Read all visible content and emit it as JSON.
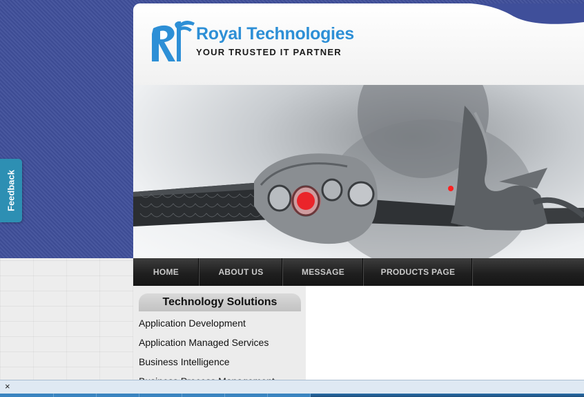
{
  "brand": {
    "name": "Royal Technologies",
    "tagline": "YOUR TRUSTED IT PARTNER",
    "colors": {
      "primary": "#2d8fd6",
      "background": "#3f4f9a"
    }
  },
  "hero": {
    "icon": "hand-with-rings-and-dragon-sword-image"
  },
  "nav": {
    "items": [
      {
        "label": "HOME"
      },
      {
        "label": "ABOUT US"
      },
      {
        "label": "MESSAGE"
      },
      {
        "label": "PRODUCTS PAGE"
      }
    ]
  },
  "sidebar": {
    "title": "Technology Solutions",
    "items": [
      {
        "label": "Application Development"
      },
      {
        "label": "Application Managed Services"
      },
      {
        "label": "Business Intelligence"
      },
      {
        "label": "Business Process Management"
      }
    ]
  },
  "feedback": {
    "label": "Feedback"
  },
  "notification_bar": {
    "close_symbol": "×"
  }
}
